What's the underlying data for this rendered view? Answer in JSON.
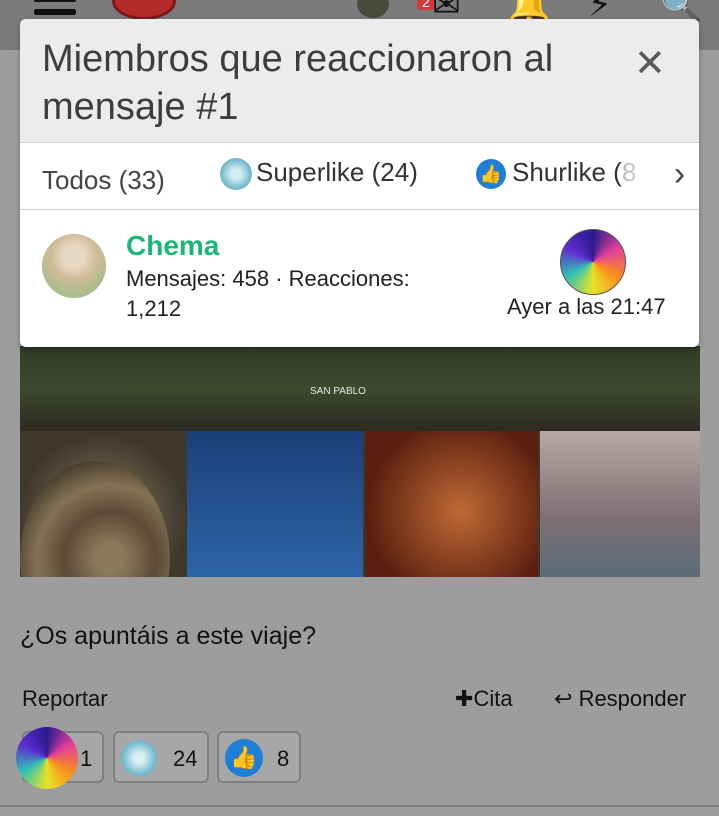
{
  "topbar": {
    "notifications_count": "2",
    "icons": [
      "menu-icon",
      "logo-icon",
      "avatar",
      "mail-icon",
      "bell-icon",
      "bolt-icon",
      "search-icon"
    ]
  },
  "modal": {
    "title": "Miembros que reaccionaron al mensaje #1",
    "close_label": "✕",
    "tabs": [
      {
        "label": "Todos (33)"
      },
      {
        "label": "Superlike (24)"
      },
      {
        "label": "Shurlike (",
        "label_faded": "8"
      }
    ],
    "next_label": "›",
    "user": {
      "name": "Chema",
      "stats": "Mensajes: 458 · Reacciones: 1,212",
      "time": "Ayer a las 21:47"
    }
  },
  "post": {
    "image_caption_logo": "SAN PABLO",
    "caption": "¿Os apuntáis a este viaje?",
    "actions": {
      "report": "Reportar",
      "quote": "Cita",
      "reply": "Responder"
    },
    "reactions": [
      {
        "count": "1"
      },
      {
        "count": "24"
      },
      {
        "count": "8"
      }
    ]
  },
  "colors": {
    "username": "#19b77a",
    "shurlike_blue": "#1e7ed8"
  }
}
